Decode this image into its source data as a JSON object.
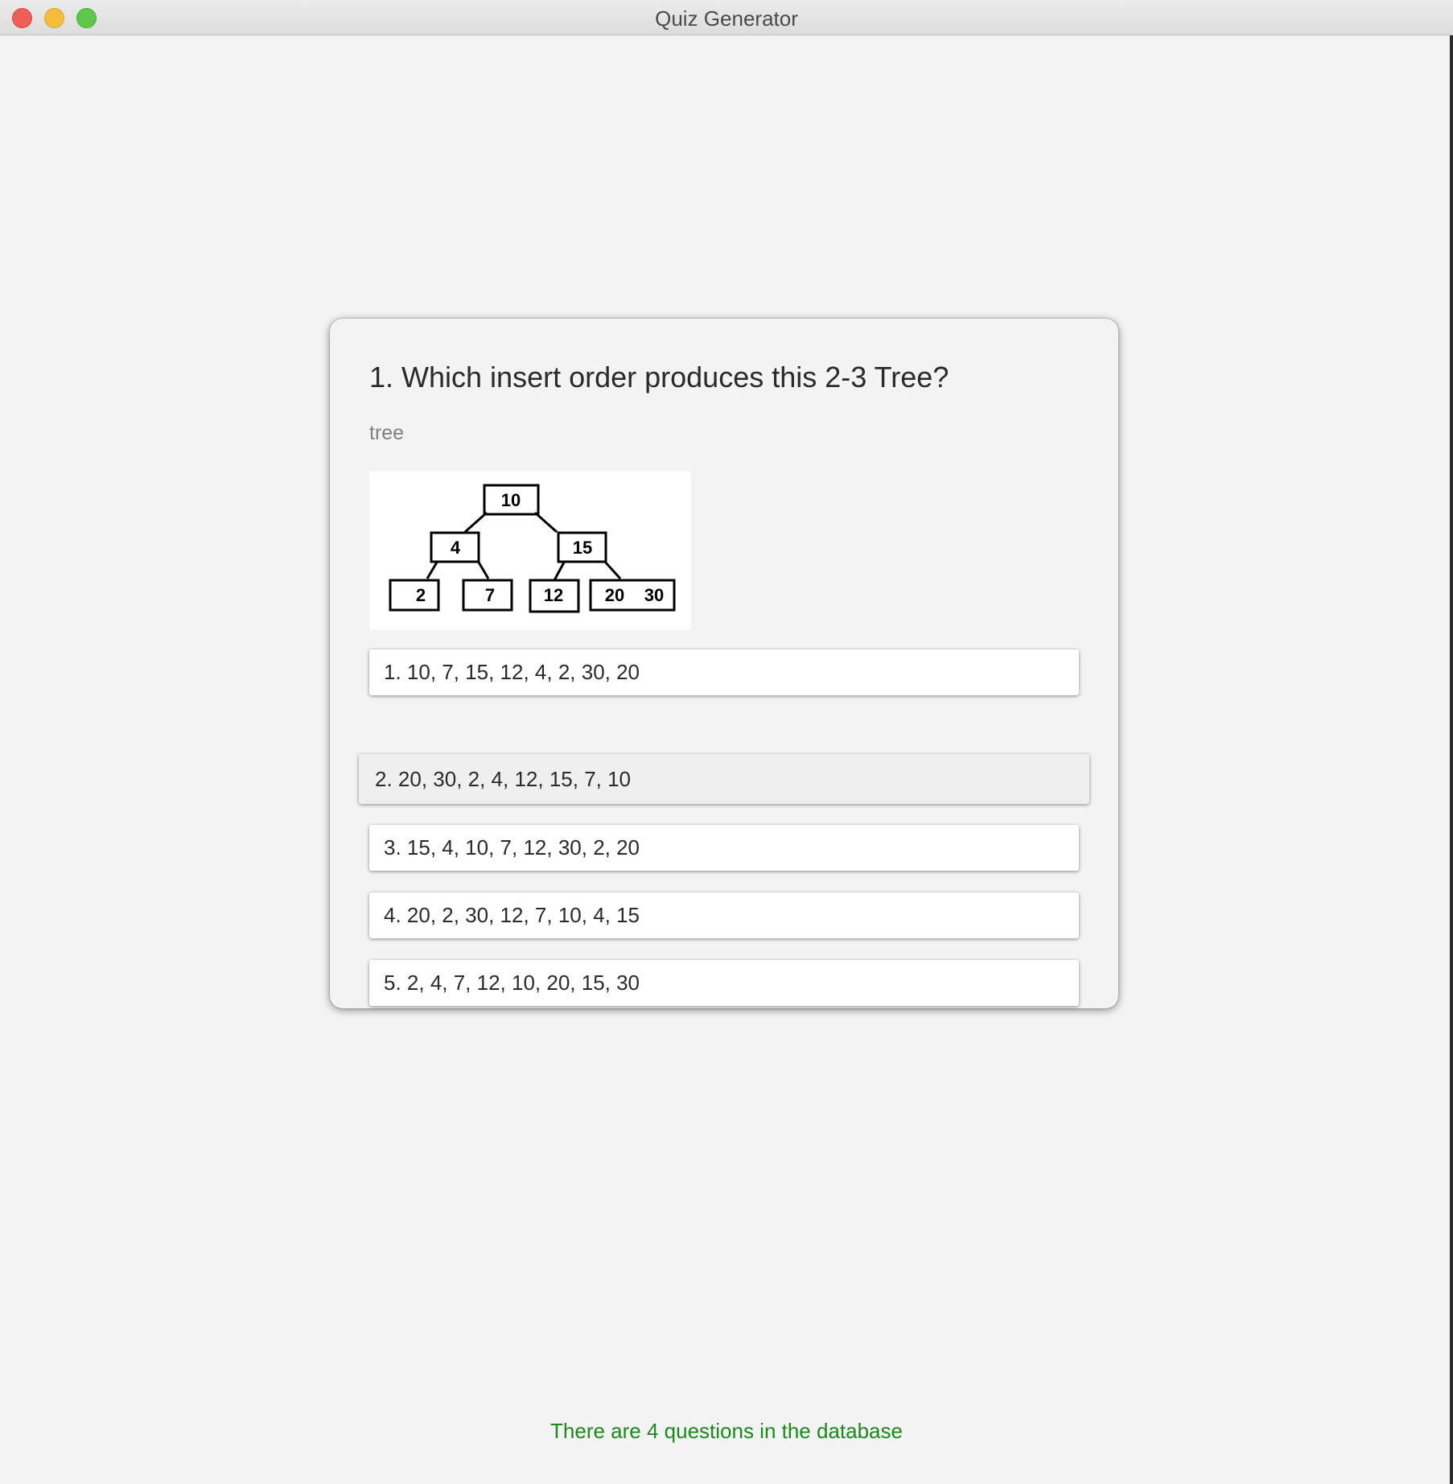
{
  "window": {
    "title": "Quiz Generator"
  },
  "question": {
    "title": "1. Which insert order produces this 2-3 Tree?",
    "topic": "tree",
    "tree_image": {
      "root": "10",
      "level1": [
        "4",
        "15"
      ],
      "leaves": [
        "2",
        "7",
        "12",
        "20",
        "30"
      ]
    }
  },
  "answers": [
    "1. 10, 7, 15, 12, 4, 2, 30, 20",
    "2. 20, 30, 2, 4, 12, 15, 7, 10",
    "3. 15, 4, 10, 7, 12, 30, 2, 20",
    "4. 20, 2, 30, 12, 7, 10, 4, 15",
    "5. 2, 4, 7, 12, 10, 20, 15, 30"
  ],
  "status": {
    "message": "There are 4 questions in the database",
    "color": "#1b8a1b"
  },
  "traffic_lights": {
    "close": "#ee5f57",
    "minimize": "#f4bd3a",
    "zoom": "#5fc84a"
  }
}
